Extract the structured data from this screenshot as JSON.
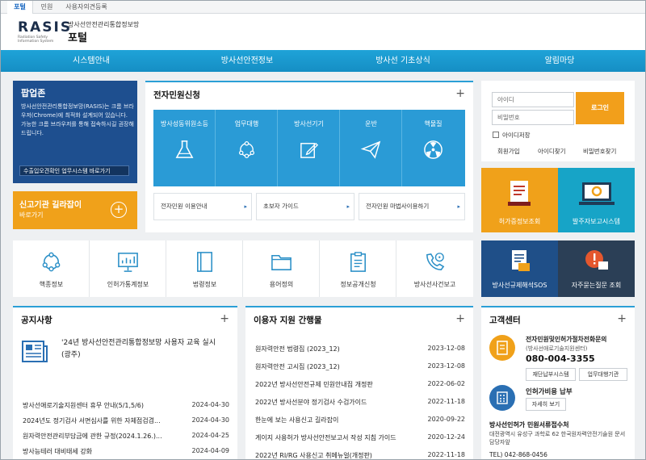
{
  "top_tabs": [
    "포털",
    "민원",
    "사용자의견등록"
  ],
  "header": {
    "logo": "RASIS",
    "logo_sub": "Radiation Safety Information System",
    "org": "방사선안전관리통합정보망",
    "portal": "포털"
  },
  "nav": [
    "시스템안내",
    "방사선안전정보",
    "방사선 기초상식",
    "알림마당"
  ],
  "popup": {
    "title": "팝업존",
    "body": "방사선안전관리통합정보망(RASIS)는 크롬 브라우저(Chrome)에 최적화 설계되어 있습니다. 가능한 크롬 브라우저를 통해 접속하시길 권장해드립니다.",
    "link": "수출입오견확인 업무시스템 바로가기"
  },
  "report": {
    "title": "신고기관 길라잡이",
    "sub": "바로가기",
    "plus": "+"
  },
  "ecivil": {
    "title": "전자민원신청",
    "plus": "+",
    "tiles": [
      "방사성동위원소등",
      "업무대행",
      "방사선기기",
      "운반",
      "핵물질"
    ],
    "sublinks": [
      "전자민원 이용안내",
      "초보자 가이드",
      "전자민원 마법사이용하기"
    ]
  },
  "login": {
    "id_placeholder": "아이디",
    "pw_placeholder": "비밀번호",
    "login_button": "로그인",
    "save_id": "아이디저장",
    "links": [
      "회원가입",
      "아이디찾기",
      "비밀번호찾기"
    ]
  },
  "quick": [
    "허가증정보조회",
    "발주자보고시스템",
    "방사선규제해석SOS",
    "자주묻는질문 조회"
  ],
  "icons": [
    "핵종정보",
    "인허가통계정보",
    "법령정보",
    "용어정의",
    "정보공개신청",
    "방사선사건보고"
  ],
  "notice": {
    "title": "공지사항",
    "plus": "+",
    "featured": "'24년 방사선안전관리통합정보망 사용자 교육 실시 (광주)",
    "items": [
      {
        "title": "방사선애로기술지원센터 휴무 안내(5/1,5/6)",
        "date": "2024-04-30"
      },
      {
        "title": "2024년도 정기검사 서면심사를 위한 자체점검겸...",
        "date": "2024-04-30"
      },
      {
        "title": "원자력안전관리부담금에 관한 규정(2024.1.26.)...",
        "date": "2024-04-25"
      },
      {
        "title": "방사능테러 대비태세 강화",
        "date": "2024-04-09"
      }
    ]
  },
  "publications": {
    "title": "이용자 지원 간행물",
    "plus": "+",
    "items": [
      {
        "title": "원자력안전 법령집 (2023_12)",
        "date": "2023-12-08"
      },
      {
        "title": "원자력안전 고시집 (2023_12)",
        "date": "2023-12-08"
      },
      {
        "title": "2022년 방사선안전규제 민원안내집 개정판",
        "date": "2022-06-02"
      },
      {
        "title": "2022년 방사선분야 정기검사 수검가이드",
        "date": "2022-11-18"
      },
      {
        "title": "한눈에 보는 사용신고 길라잡이",
        "date": "2020-09-22"
      },
      {
        "title": "게이지 사용허가 방사선안전보고서 작성 지침 가이드",
        "date": "2020-12-24"
      },
      {
        "title": "2022년 RI/RG 사용신고 취메뉴얼(개정판)",
        "date": "2022-11-18"
      }
    ]
  },
  "customer": {
    "title": "고객센터",
    "plus": "+",
    "item1_title": "전자민원및인허가절차전화문의",
    "item1_sub": "(방사선애로기술지원센터)",
    "phone": "080-004-3355",
    "btn1": "재단납부시스템",
    "btn2": "업무대행기관",
    "item2_title": "인허가비용 납부",
    "btn3": "자세히 보기",
    "org_title": "방사선인허가 민원서류접수처",
    "address": "대전광역시 유성구 과학로 62 한국원자력안전기술원 문서담당자앞",
    "tel": "TEL) 042-868-0456"
  },
  "colors": {
    "nav": "#1a9ad0",
    "accent_orange": "#f0a11a",
    "popup_blue": "#1e4f8f",
    "tile_blue": "#2a9bd6"
  }
}
